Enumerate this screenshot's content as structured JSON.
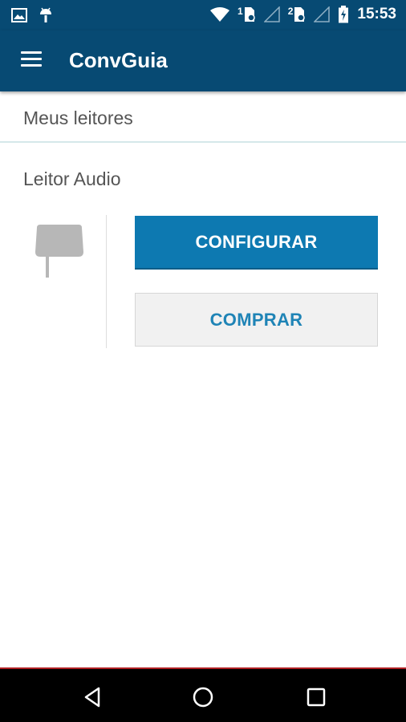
{
  "status_bar": {
    "time": "15:53",
    "sim1_label": "1",
    "sim2_label": "2",
    "icons": [
      "image-icon",
      "android-icon",
      "wifi-icon",
      "sim1-icon",
      "signal1-icon",
      "sim2-icon",
      "signal2-icon",
      "battery-icon"
    ]
  },
  "app_bar": {
    "title": "ConvGuia",
    "menu_icon": "hamburger-menu-icon"
  },
  "content": {
    "section_title": "Meus leitores",
    "reader": {
      "name": "Leitor Audio",
      "icon": "audio-reader-icon",
      "configure_label": "CONFIGURAR",
      "buy_label": "COMPRAR"
    }
  },
  "nav_bar": {
    "buttons": [
      "back-icon",
      "home-icon",
      "recents-icon"
    ]
  },
  "colors": {
    "primary": "#074a73",
    "button_primary": "#0d79b1",
    "button_secondary_text": "#1f84b6",
    "nav_accent": "#b01e22"
  }
}
